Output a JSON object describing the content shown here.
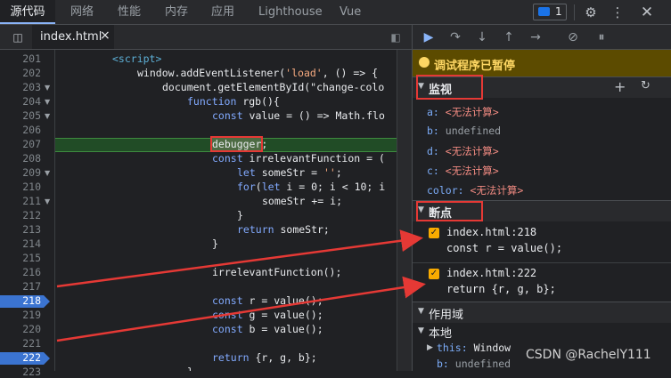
{
  "tabs": [
    {
      "label": "源代码",
      "active": true
    },
    {
      "label": "网络"
    },
    {
      "label": "性能"
    },
    {
      "label": "内存"
    },
    {
      "label": "应用"
    },
    {
      "label": "Lighthouse"
    },
    {
      "label": "Vue"
    }
  ],
  "issues_count": "1",
  "editor": {
    "file_tab": "index.html",
    "close": "×",
    "line_numbers": [
      "201",
      "202",
      "203",
      "204",
      "205",
      "206",
      "207",
      "208",
      "209",
      "210",
      "211",
      "212",
      "213",
      "214",
      "215",
      "216",
      "217",
      "218",
      "219",
      "220",
      "221",
      "222",
      "223"
    ],
    "breakpoint_lines": [
      "218",
      "222"
    ],
    "paused_line": "207",
    "code": [
      "<script>",
      "window.addEventListener('load', () => {",
      "document.getElementById(\"change-colo",
      "function rgb(){",
      "const value = () => Math.flo",
      "",
      "debugger;",
      "const irrelevantFunction = (",
      "let someStr = '';",
      "for(let i = 0; i < 10; i",
      "someStr += i;",
      "}",
      "return someStr;",
      "}",
      "",
      "irrelevantFunction();",
      "",
      "const r = value();",
      "const g = value();",
      "const b = value();",
      "",
      "return {r, g, b};",
      "}"
    ]
  },
  "debugger": {
    "paused_text": "调试程序已暂停",
    "watch_title": "监视",
    "watch": [
      {
        "key": "a:",
        "value": "<无法计算>"
      },
      {
        "key": "b:",
        "value": "undefined"
      },
      {
        "key": "d:",
        "value": "<无法计算>"
      },
      {
        "key": "c:",
        "value": "<无法计算>"
      },
      {
        "key": "color:",
        "value": "<无法计算>"
      }
    ],
    "breakpoints_title": "断点",
    "breakpoints": [
      {
        "location": "index.html:218",
        "code": "const r = value();"
      },
      {
        "location": "index.html:222",
        "code": "return {r, g, b};"
      }
    ],
    "scope_title": "作用域",
    "local_title": "本地",
    "scope_items": [
      {
        "key": "this:",
        "value": "Window"
      },
      {
        "key": "b:",
        "value": "undefined"
      }
    ]
  },
  "watermark": "CSDN @RachelY111",
  "colors": {
    "accent": "#8ab4f8",
    "breakpoint": "#3b74d1",
    "annotation": "#e53935",
    "paused_bg": "#5c4b00"
  }
}
